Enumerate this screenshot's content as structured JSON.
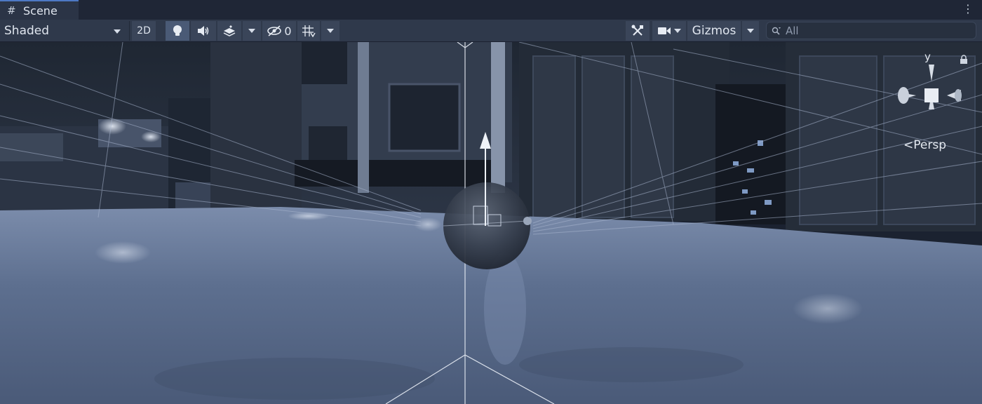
{
  "tab": {
    "icon": "hash-grid-icon",
    "title": "Scene"
  },
  "toolbar": {
    "draw_mode": "Shaded",
    "mode_2d": "2D",
    "hidden_count": "0",
    "gizmos": "Gizmos",
    "search_placeholder": "All"
  },
  "orientation_gizmo": {
    "axis_label": "y",
    "projection": "Persp",
    "projection_arrow": "<"
  },
  "colors": {
    "tab_accent": "#4d78c4",
    "toolbar_bg": "#2f394b",
    "floor": "#5e7090",
    "walls": "#2a3342"
  }
}
